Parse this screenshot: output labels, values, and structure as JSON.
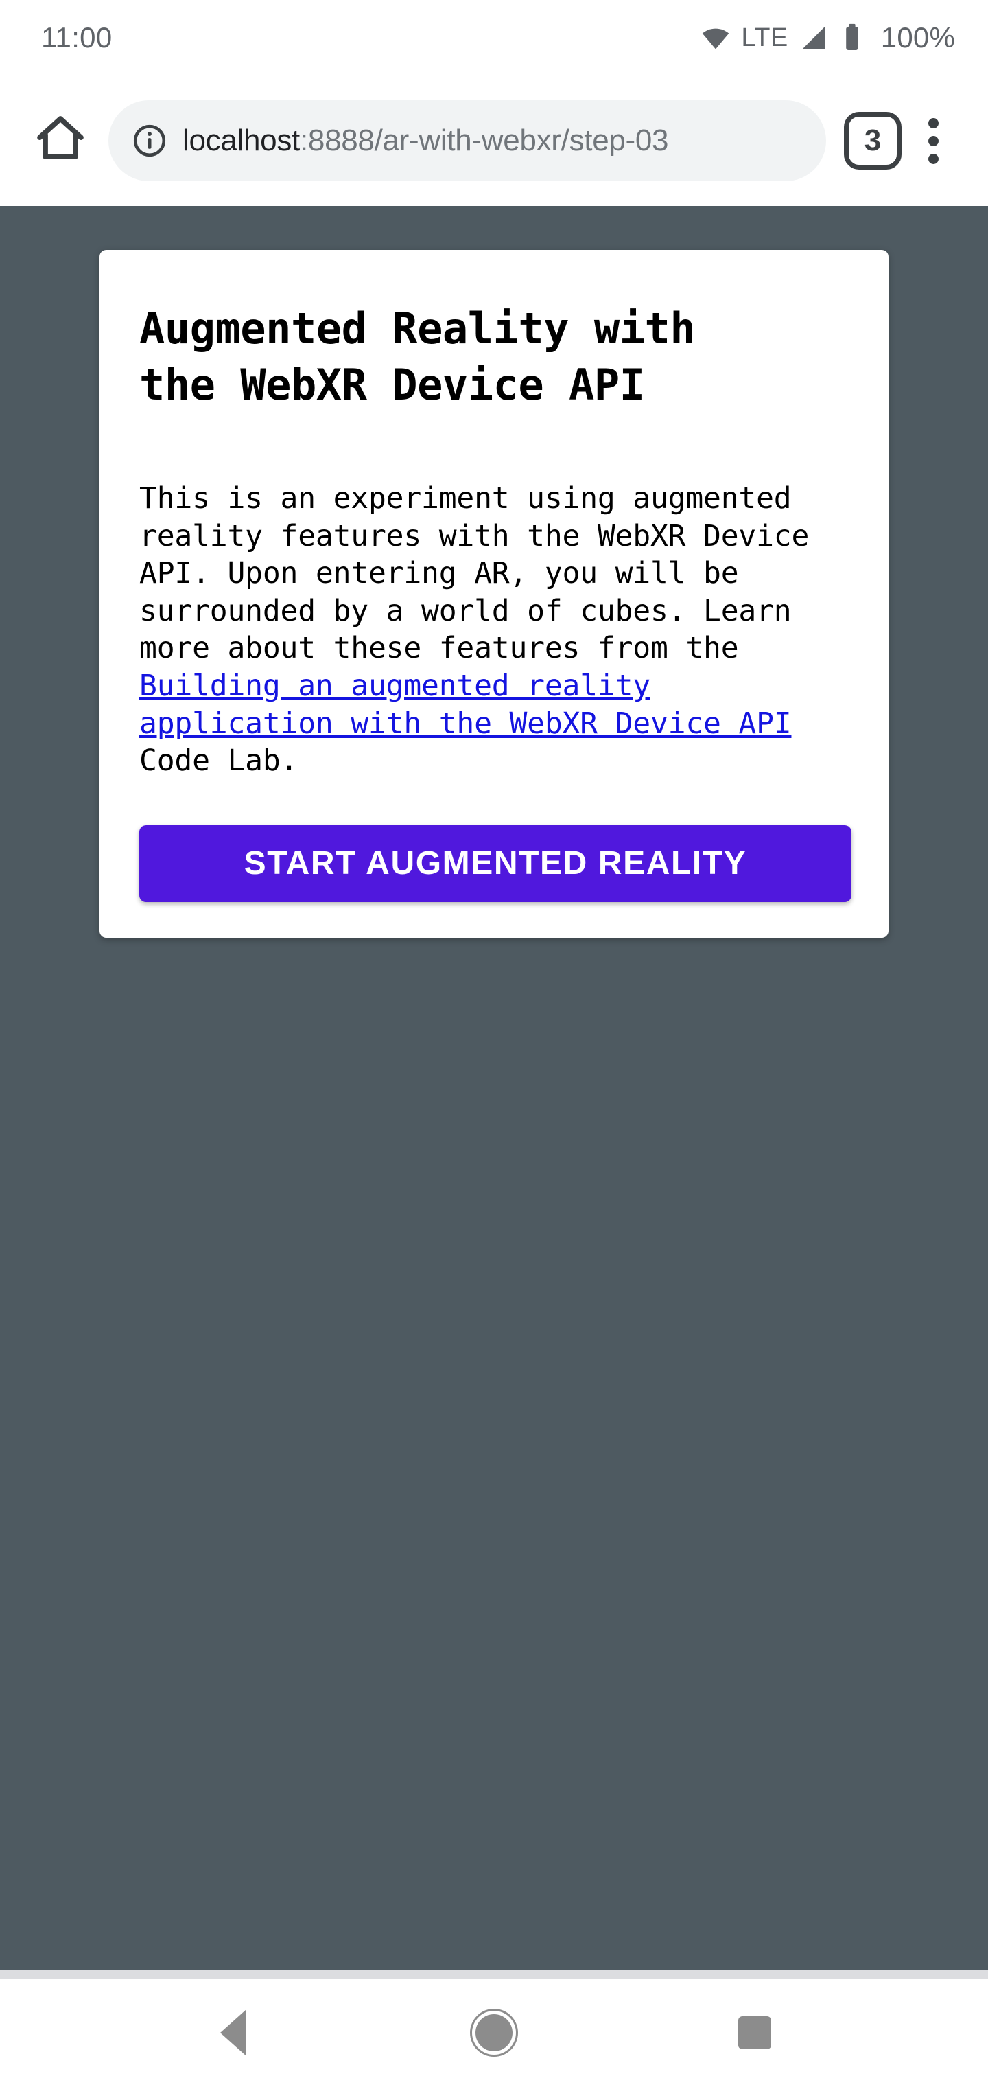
{
  "status_bar": {
    "clock": "11:00",
    "network_label": "LTE",
    "battery_percent": "100%",
    "icons": [
      "wifi-icon",
      "signal-icon",
      "battery-icon"
    ]
  },
  "browser": {
    "home_icon": "home-icon",
    "security_icon": "info-icon",
    "url_host": "localhost",
    "url_path": ":8888/ar-with-webxr/step-03",
    "url_full": "localhost:8888/ar-with-webxr/step-03",
    "tab_count": "3",
    "menu_icon": "overflow-menu-icon"
  },
  "page": {
    "background_color": "#4e5a61",
    "card": {
      "title": "Augmented Reality with\nthe WebXR Device API",
      "body_before_link": "This is an experiment using augmented reality features with the WebXR Device API. Upon entering AR, you will be surrounded by a world of cubes. Learn more about these features from the ",
      "link_text": "Building an augmented reality application with the WebXR Device API",
      "body_after_link": " Code Lab.",
      "button_label": "START AUGMENTED REALITY",
      "button_color": "#5018dd",
      "link_color": "#1414e0"
    }
  },
  "system_nav": {
    "back_label": "Back",
    "home_label": "Home",
    "recents_label": "Recents"
  }
}
